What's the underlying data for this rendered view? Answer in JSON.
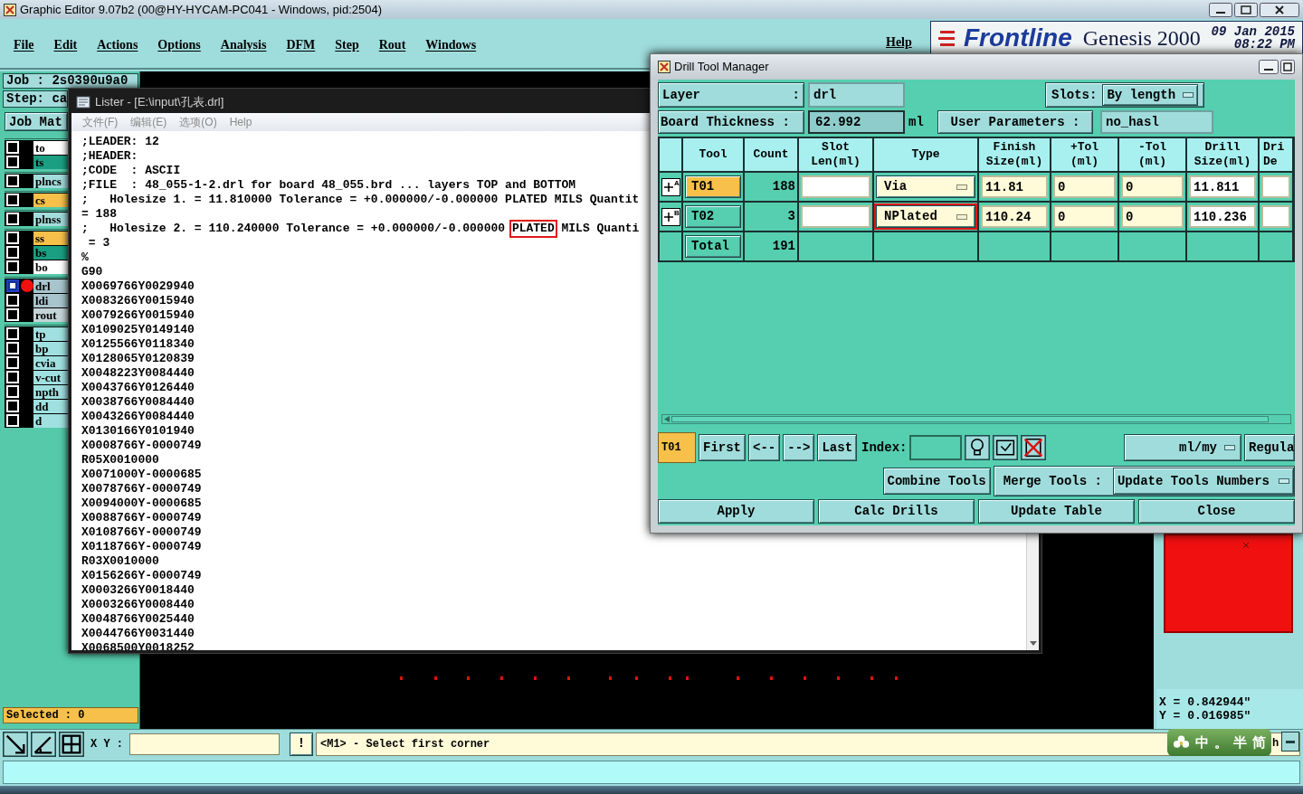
{
  "main_window": {
    "title": "Graphic Editor 9.07b2 (00@HY-HYCAM-PC041 - Windows, pid:2504)",
    "menu": [
      "File",
      "Edit",
      "Actions",
      "Options",
      "Analysis",
      "DFM",
      "Step",
      "Rout",
      "Windows"
    ],
    "help": "Help",
    "brand": {
      "logo": "Frontline",
      "product": "Genesis 2000",
      "date": "09 Jan 2015",
      "time": "08:22 PM"
    }
  },
  "job_panel": {
    "job": "Job : 2s0390u9a0",
    "step": "Step: ca",
    "matrix_button": "Job Mat",
    "layer_groups": [
      [
        {
          "name": "to",
          "color": "#ffffff",
          "selected": false,
          "work": false
        },
        {
          "name": "ts",
          "color": "#1a9f82",
          "selected": false,
          "work": false
        }
      ],
      [
        {
          "name": "plncs",
          "color": "#a4dcdc",
          "selected": false,
          "work": false
        }
      ],
      [
        {
          "name": "cs",
          "color": "#f6c04a",
          "selected": false,
          "work": false
        }
      ],
      [
        {
          "name": "plnss",
          "color": "#a4dcdc",
          "selected": false,
          "work": false
        }
      ],
      [
        {
          "name": "ss",
          "color": "#f6c04a",
          "selected": false,
          "work": false
        },
        {
          "name": "bs",
          "color": "#1a9f82",
          "selected": false,
          "work": false
        },
        {
          "name": "bo",
          "color": "#ffffff",
          "selected": false,
          "work": false
        }
      ],
      [
        {
          "name": "drl",
          "color": "#a8c4cc",
          "selected": true,
          "work": true
        },
        {
          "name": "ldi",
          "color": "#a8c4cc",
          "selected": false,
          "work": false
        },
        {
          "name": "rout",
          "color": "#c4d4d8",
          "selected": false,
          "work": false
        }
      ],
      [
        {
          "name": "tp",
          "color": "#a0e0e0",
          "selected": false,
          "work": false
        },
        {
          "name": "bp",
          "color": "#a0e0e0",
          "selected": false,
          "work": false
        },
        {
          "name": "cvia",
          "color": "#a0e0e0",
          "selected": false,
          "work": false
        },
        {
          "name": "v-cut",
          "color": "#a0e0e0",
          "selected": false,
          "work": false
        },
        {
          "name": "npth",
          "color": "#a0e0e0",
          "selected": false,
          "work": false
        },
        {
          "name": "dd",
          "color": "#a0e0e0",
          "selected": false,
          "work": false
        },
        {
          "name": "d",
          "color": "#a0e0e0",
          "selected": false,
          "work": false
        }
      ]
    ],
    "selected_count": "Selected : 0"
  },
  "coordinates": {
    "x": "X = 0.842944\"",
    "y": "Y = 0.016985\""
  },
  "command_bar": {
    "xy_label": "X Y :",
    "alert_button": "!",
    "prompt": "<M1> - Select first corner",
    "ime": [
      "中",
      "。",
      "半",
      "简"
    ],
    "cut_text": "h"
  },
  "lister": {
    "title": "Lister - [E:\\input\\孔表.drl]",
    "menu": [
      "文件(F)",
      "编辑(E)",
      "选项(O)",
      "Help"
    ],
    "lines": [
      {
        "text": ";LEADER: 12"
      },
      {
        "text": ";HEADER:"
      },
      {
        "text": ";CODE  : ASCII"
      },
      {
        "text": ";FILE  : 48_055-1-2.drl for board 48_055.brd ... layers TOP and BOTTOM"
      },
      {
        "text": ";   Holesize 1. = 11.810000 Tolerance = +0.000000/-0.000000 PLATED MILS Quantit"
      },
      {
        "text": "= 188"
      },
      {
        "segments": [
          {
            "text": ";   Holesize 2. = 110.240000 Tolerance = +0.000000/-0.000000 ",
            "boxed": false
          },
          {
            "text": "PLATED",
            "boxed": true
          },
          {
            "text": " MILS Quanti",
            "boxed": false
          }
        ]
      },
      {
        "text": " = 3"
      },
      {
        "text": "%"
      },
      {
        "text": "G90"
      },
      {
        "text": "X0069766Y0029940"
      },
      {
        "text": "X0083266Y0015940"
      },
      {
        "text": "X0079266Y0015940"
      },
      {
        "text": "X0109025Y0149140"
      },
      {
        "text": "X0125566Y0118340"
      },
      {
        "text": "X0128065Y0120839"
      },
      {
        "text": "X0048223Y0084440"
      },
      {
        "text": "X0043766Y0126440"
      },
      {
        "text": "X0038766Y0084440"
      },
      {
        "text": "X0043266Y0084440"
      },
      {
        "text": "X0130166Y0101940"
      },
      {
        "text": "X0008766Y-0000749"
      },
      {
        "text": "R05X0010000"
      },
      {
        "text": "X0071000Y-0000685"
      },
      {
        "text": "X0078766Y-0000749"
      },
      {
        "text": "X0094000Y-0000685"
      },
      {
        "text": "X0088766Y-0000749"
      },
      {
        "text": "X0108766Y-0000749"
      },
      {
        "text": "X0118766Y-0000749"
      },
      {
        "text": "R03X0010000"
      },
      {
        "text": "X0156266Y-0000749"
      },
      {
        "text": "X0003266Y0018440"
      },
      {
        "text": "X0003266Y0008440"
      },
      {
        "text": "X0048766Y0025440"
      },
      {
        "text": "X0044766Y0031440"
      },
      {
        "text": "X0068500Y0018252"
      }
    ]
  },
  "drill_tool_manager": {
    "title": "Drill Tool Manager",
    "layer": {
      "label": "Layer",
      "colon": ":",
      "value": "drl"
    },
    "slots": {
      "label": "Slots:",
      "value": "By length"
    },
    "board_thickness": {
      "label": "Board Thickness :",
      "value": "62.992",
      "unit": "ml"
    },
    "user_parameters": {
      "label": "User Parameters :",
      "value": "no_hasl"
    },
    "columns": [
      "Tool",
      "Count",
      "Slot\nLen(ml)",
      "Type",
      "Finish\nSize(ml)",
      "+Tol\n(ml)",
      "-Tol\n(ml)",
      "Drill\nSize(ml)",
      "Dri\nDe"
    ],
    "rows": [
      {
        "mark": "A",
        "tool": "T01",
        "selected": true,
        "count": "188",
        "type": "Via",
        "type_boxed": false,
        "finish": "11.81",
        "plus_tol": "0",
        "minus_tol": "0",
        "drill": "11.811"
      },
      {
        "mark": "B",
        "tool": "T02",
        "selected": false,
        "count": "3",
        "type": "NPlated",
        "type_boxed": true,
        "finish": "110.24",
        "plus_tol": "0",
        "minus_tol": "0",
        "drill": "110.236"
      }
    ],
    "total": {
      "label": "Total",
      "count": "191"
    },
    "navigation": {
      "current": "T01",
      "buttons": [
        "First",
        "<--",
        "-->",
        "Last"
      ],
      "index_label": "Index:",
      "units": "ml/my",
      "cut_button": "Regula"
    },
    "tools_row": {
      "combine": "Combine Tools",
      "merge_label": "Merge Tools :",
      "merge_value": "Update Tools Numbers"
    },
    "buttons": [
      "Apply",
      "Calc Drills",
      "Update Table",
      "Close"
    ]
  }
}
